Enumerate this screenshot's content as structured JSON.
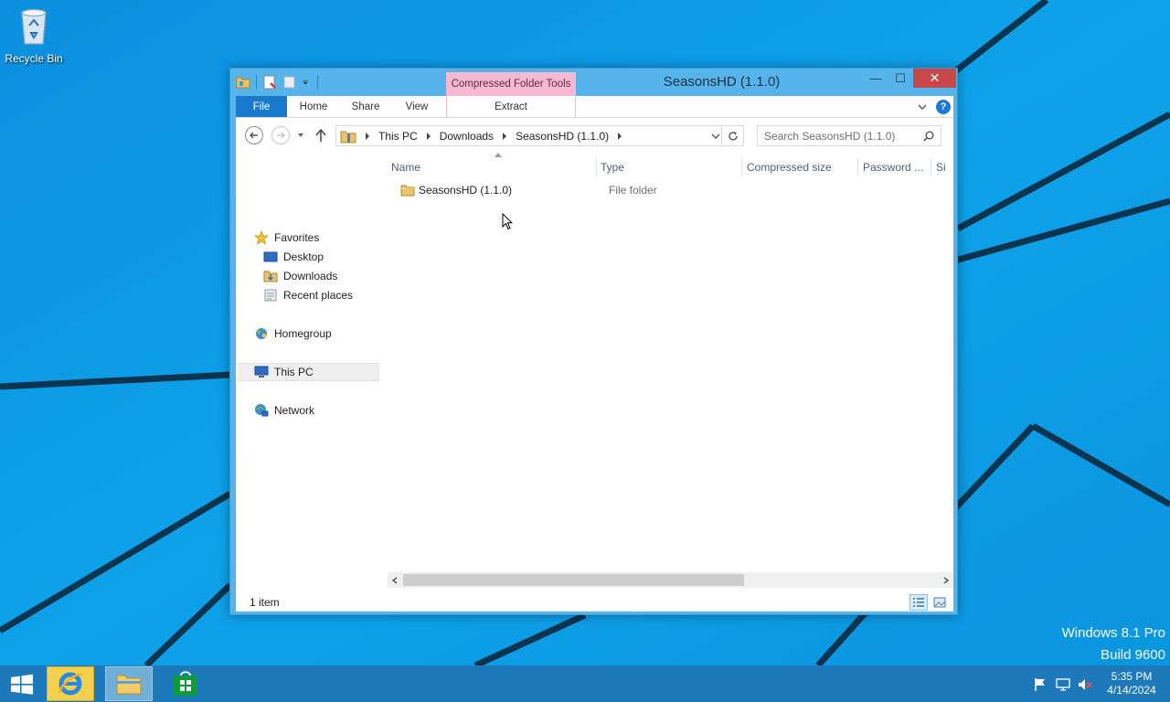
{
  "desktop": {
    "recycle_bin_label": "Recycle Bin",
    "watermark_line1": "Windows 8.1 Pro",
    "watermark_line2": "Build 9600"
  },
  "window": {
    "title": "SeasonsHD (1.1.0)",
    "context_tab_group": "Compressed Folder Tools",
    "minimize_glyph": "—",
    "maximize_glyph": "☐",
    "close_glyph": "✕"
  },
  "ribbon": {
    "tabs": [
      {
        "label": "File"
      },
      {
        "label": "Home"
      },
      {
        "label": "Share"
      },
      {
        "label": "View"
      },
      {
        "label": "Extract"
      }
    ],
    "help_glyph": "?"
  },
  "address": {
    "crumbs": [
      "This PC",
      "Downloads",
      "SeasonsHD (1.1.0)"
    ]
  },
  "search": {
    "placeholder": "Search SeasonsHD (1.1.0)"
  },
  "nav_pane": {
    "favorites": "Favorites",
    "desktop": "Desktop",
    "downloads": "Downloads",
    "recent_places": "Recent places",
    "homegroup": "Homegroup",
    "this_pc": "This PC",
    "network": "Network"
  },
  "file_list": {
    "columns": [
      "Name",
      "Type",
      "Compressed size",
      "Password ...",
      "Si"
    ],
    "rows": [
      {
        "name": "SeasonsHD (1.1.0)",
        "type": "File folder"
      }
    ]
  },
  "status": {
    "item_count": "1 item"
  },
  "taskbar": {
    "time": "5:35 PM",
    "date": "4/14/2024",
    "pinned": [
      "internet-explorer",
      "file-explorer",
      "store"
    ]
  },
  "colors": {
    "desktop_bg": "#0a9be3",
    "window_frame": "#56b4ea",
    "file_tab": "#1979ca",
    "context_tab": "#f7b8d2",
    "close_button": "#c74848",
    "taskbar": "#1d79b9"
  }
}
